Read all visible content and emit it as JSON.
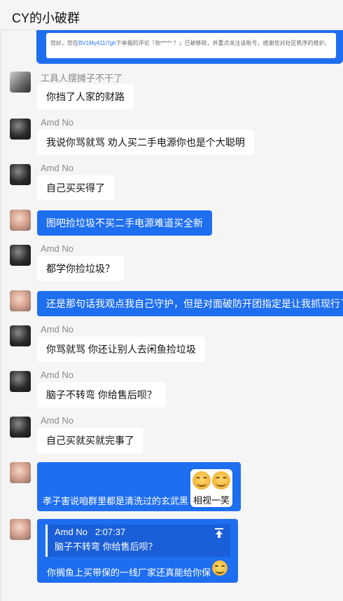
{
  "window": {
    "title": "CY的小破群"
  },
  "top_notice": {
    "prefix": "您好，您在",
    "link": "BV1My411i7gh",
    "suffix": "下举报的评论『你***** ？』已被移除，并重点关注该账号，感谢您对社区秩序的维护。"
  },
  "messages": [
    {
      "sender": "工具人摆摊子不干了",
      "text": "你挡了人家的财路",
      "avatar": "photo-avatar"
    },
    {
      "sender": "Amd No",
      "text": "我说你骂就骂 劝人买二手电源你也是个大聪明",
      "avatar": "dark-avatar"
    },
    {
      "sender": "Amd No",
      "text": "自己买买得了",
      "avatar": "dark-avatar"
    },
    {
      "text": "图吧捡垃圾不买二手电源难道买全新",
      "avatar": "self-avatar"
    },
    {
      "sender": "Amd No",
      "text": "都学你捡垃圾？",
      "avatar": "dark-avatar"
    },
    {
      "text": "还是那句话我观点我自己守护，但是对面破防开团指定是让我抓现行了",
      "avatar": "self-avatar"
    },
    {
      "sender": "Amd No",
      "text": "你骂就骂 你还让别人去闲鱼捡垃圾",
      "avatar": "dark-avatar"
    },
    {
      "sender": "Amd No",
      "text": "脑子不转弯 你给售后呗？",
      "avatar": "dark-avatar"
    },
    {
      "sender": "Amd No",
      "text": "自己买就买就完事了",
      "avatar": "dark-avatar"
    },
    {
      "text": "孝子害说咱群里都是清洗过的玄武黑",
      "emoji_caption": "相视一笑",
      "avatar": "self-avatar"
    },
    {
      "quote": {
        "name": "Amd No",
        "time": "2:07:37",
        "text": "脑子不转弯 你给售后呗？"
      },
      "text": "你搁鱼上买带保的一线厂家还真能给你保",
      "avatar": "self-avatar"
    }
  ]
}
